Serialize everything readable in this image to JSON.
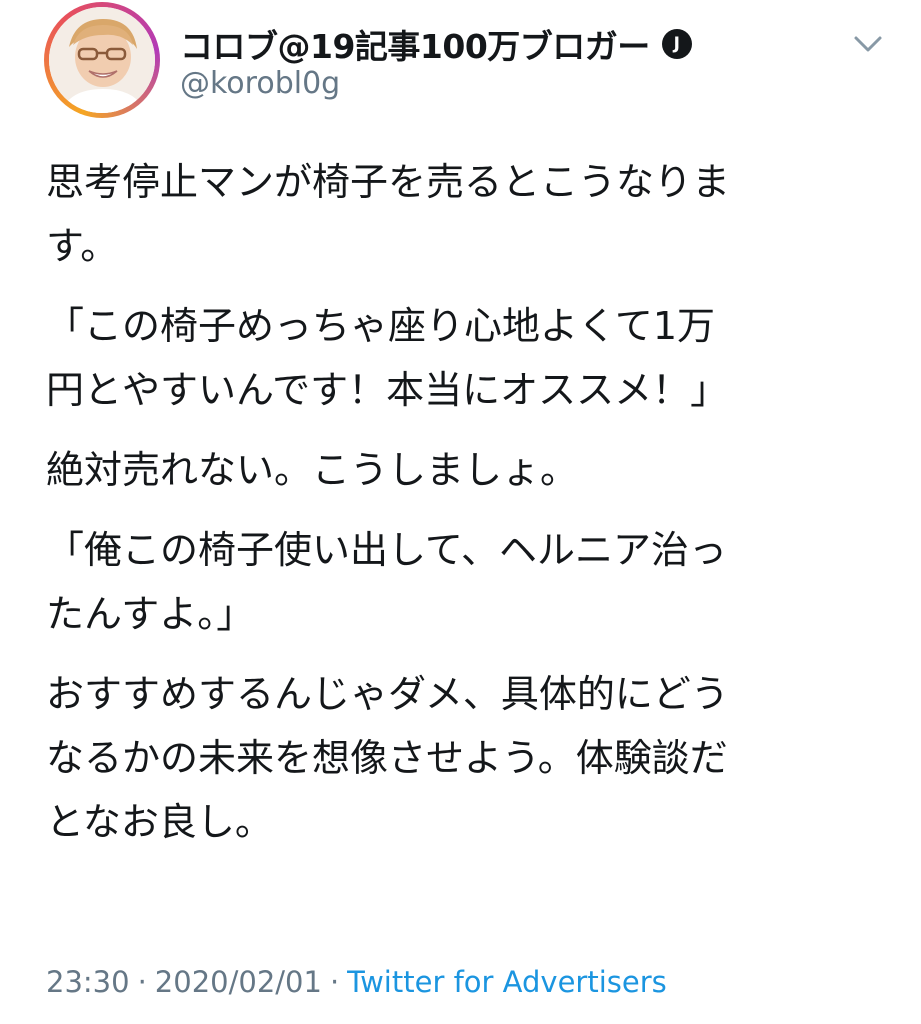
{
  "tweet": {
    "author": {
      "display_name": "コロブ@19記事100万ブロガー",
      "verified_badge": "J",
      "handle": "@korobl0g",
      "avatar_icon": "avatar-photo-icon"
    },
    "menu_icon": "chevron-down-icon",
    "paragraphs": [
      "思考停止マンが椅子を売るとこうなりま\nす。",
      "「この椅子めっちゃ座り心地よくて1万\n円とやすいんです！本当にオススメ！」",
      "絶対売れない。こうしましょ。",
      "「俺この椅子使い出して、ヘルニア治っ\nたんすよ。」",
      "おすすめするんじゃダメ、具体的にどう\nなるかの未来を想像させよう。体験談だ\nとなお良し。"
    ],
    "time": "23:30",
    "date": "2020/02/01",
    "separator": "·",
    "source": "Twitter for Advertisers"
  },
  "colors": {
    "text": "#14171a",
    "secondary": "#657786",
    "link": "#1b95e0",
    "background": "#ffffff"
  }
}
